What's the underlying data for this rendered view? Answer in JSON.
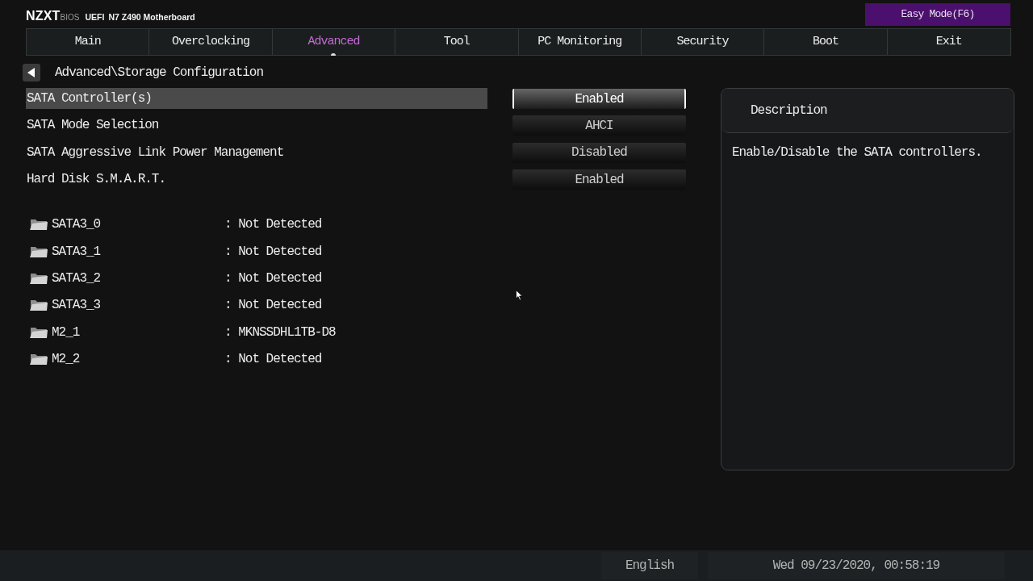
{
  "header": {
    "brand": "NZXT",
    "brand_suffix": "BIOS",
    "firmware": "UEFI",
    "board": "N7 Z490 Motherboard",
    "mode_button": "Easy Mode(F6)"
  },
  "tabs": [
    {
      "label": "Main",
      "selected": false
    },
    {
      "label": "Overclocking",
      "selected": false
    },
    {
      "label": "Advanced",
      "selected": true
    },
    {
      "label": "Tool",
      "selected": false
    },
    {
      "label": "PC Monitoring",
      "selected": false
    },
    {
      "label": "Security",
      "selected": false
    },
    {
      "label": "Boot",
      "selected": false
    },
    {
      "label": "Exit",
      "selected": false
    }
  ],
  "breadcrumb": "Advanced\\Storage Configuration",
  "settings": [
    {
      "label": "SATA Controller(s)",
      "value": "Enabled",
      "selected": true
    },
    {
      "label": "SATA Mode Selection",
      "value": "AHCI",
      "selected": false
    },
    {
      "label": "SATA Aggressive Link Power Management",
      "value": "Disabled",
      "selected": false
    },
    {
      "label": "Hard Disk S.M.A.R.T.",
      "value": "Enabled",
      "selected": false
    }
  ],
  "devices": [
    {
      "name": "SATA3_0",
      "status": ": Not Detected"
    },
    {
      "name": "SATA3_1",
      "status": ": Not Detected"
    },
    {
      "name": "SATA3_2",
      "status": ": Not Detected"
    },
    {
      "name": "SATA3_3",
      "status": ": Not Detected"
    },
    {
      "name": "M2_1",
      "status": ": MKNSSDHL1TB-D8"
    },
    {
      "name": "M2_2",
      "status": ": Not Detected"
    }
  ],
  "description": {
    "title": "Description",
    "text": "Enable/Disable the SATA controllers."
  },
  "status_bar": {
    "language": "English",
    "datetime": "Wed 09/23/2020, 00:58:19"
  }
}
